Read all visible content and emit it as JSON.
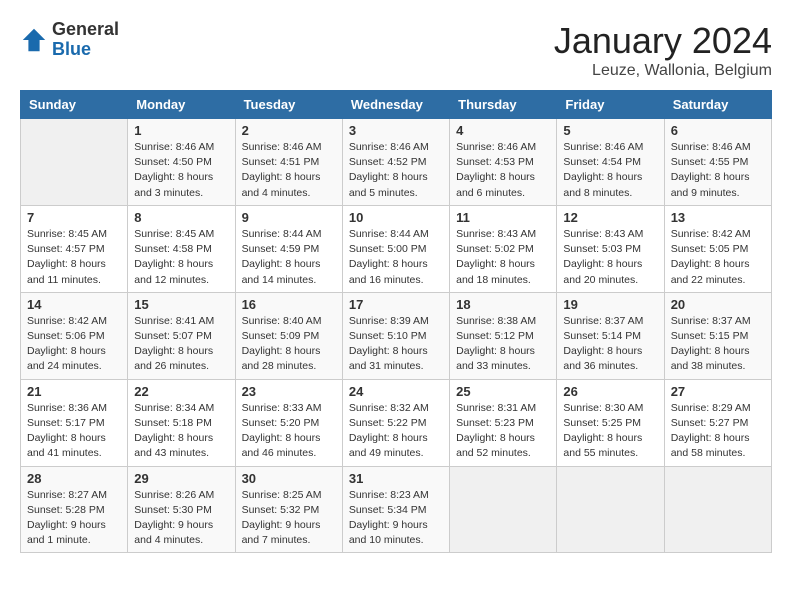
{
  "header": {
    "logo_general": "General",
    "logo_blue": "Blue",
    "month_title": "January 2024",
    "location": "Leuze, Wallonia, Belgium"
  },
  "days_of_week": [
    "Sunday",
    "Monday",
    "Tuesday",
    "Wednesday",
    "Thursday",
    "Friday",
    "Saturday"
  ],
  "weeks": [
    [
      {
        "day": "",
        "info": ""
      },
      {
        "day": "1",
        "info": "Sunrise: 8:46 AM\nSunset: 4:50 PM\nDaylight: 8 hours and 3 minutes."
      },
      {
        "day": "2",
        "info": "Sunrise: 8:46 AM\nSunset: 4:51 PM\nDaylight: 8 hours and 4 minutes."
      },
      {
        "day": "3",
        "info": "Sunrise: 8:46 AM\nSunset: 4:52 PM\nDaylight: 8 hours and 5 minutes."
      },
      {
        "day": "4",
        "info": "Sunrise: 8:46 AM\nSunset: 4:53 PM\nDaylight: 8 hours and 6 minutes."
      },
      {
        "day": "5",
        "info": "Sunrise: 8:46 AM\nSunset: 4:54 PM\nDaylight: 8 hours and 8 minutes."
      },
      {
        "day": "6",
        "info": "Sunrise: 8:46 AM\nSunset: 4:55 PM\nDaylight: 8 hours and 9 minutes."
      }
    ],
    [
      {
        "day": "7",
        "info": "Sunrise: 8:45 AM\nSunset: 4:57 PM\nDaylight: 8 hours and 11 minutes."
      },
      {
        "day": "8",
        "info": "Sunrise: 8:45 AM\nSunset: 4:58 PM\nDaylight: 8 hours and 12 minutes."
      },
      {
        "day": "9",
        "info": "Sunrise: 8:44 AM\nSunset: 4:59 PM\nDaylight: 8 hours and 14 minutes."
      },
      {
        "day": "10",
        "info": "Sunrise: 8:44 AM\nSunset: 5:00 PM\nDaylight: 8 hours and 16 minutes."
      },
      {
        "day": "11",
        "info": "Sunrise: 8:43 AM\nSunset: 5:02 PM\nDaylight: 8 hours and 18 minutes."
      },
      {
        "day": "12",
        "info": "Sunrise: 8:43 AM\nSunset: 5:03 PM\nDaylight: 8 hours and 20 minutes."
      },
      {
        "day": "13",
        "info": "Sunrise: 8:42 AM\nSunset: 5:05 PM\nDaylight: 8 hours and 22 minutes."
      }
    ],
    [
      {
        "day": "14",
        "info": "Sunrise: 8:42 AM\nSunset: 5:06 PM\nDaylight: 8 hours and 24 minutes."
      },
      {
        "day": "15",
        "info": "Sunrise: 8:41 AM\nSunset: 5:07 PM\nDaylight: 8 hours and 26 minutes."
      },
      {
        "day": "16",
        "info": "Sunrise: 8:40 AM\nSunset: 5:09 PM\nDaylight: 8 hours and 28 minutes."
      },
      {
        "day": "17",
        "info": "Sunrise: 8:39 AM\nSunset: 5:10 PM\nDaylight: 8 hours and 31 minutes."
      },
      {
        "day": "18",
        "info": "Sunrise: 8:38 AM\nSunset: 5:12 PM\nDaylight: 8 hours and 33 minutes."
      },
      {
        "day": "19",
        "info": "Sunrise: 8:37 AM\nSunset: 5:14 PM\nDaylight: 8 hours and 36 minutes."
      },
      {
        "day": "20",
        "info": "Sunrise: 8:37 AM\nSunset: 5:15 PM\nDaylight: 8 hours and 38 minutes."
      }
    ],
    [
      {
        "day": "21",
        "info": "Sunrise: 8:36 AM\nSunset: 5:17 PM\nDaylight: 8 hours and 41 minutes."
      },
      {
        "day": "22",
        "info": "Sunrise: 8:34 AM\nSunset: 5:18 PM\nDaylight: 8 hours and 43 minutes."
      },
      {
        "day": "23",
        "info": "Sunrise: 8:33 AM\nSunset: 5:20 PM\nDaylight: 8 hours and 46 minutes."
      },
      {
        "day": "24",
        "info": "Sunrise: 8:32 AM\nSunset: 5:22 PM\nDaylight: 8 hours and 49 minutes."
      },
      {
        "day": "25",
        "info": "Sunrise: 8:31 AM\nSunset: 5:23 PM\nDaylight: 8 hours and 52 minutes."
      },
      {
        "day": "26",
        "info": "Sunrise: 8:30 AM\nSunset: 5:25 PM\nDaylight: 8 hours and 55 minutes."
      },
      {
        "day": "27",
        "info": "Sunrise: 8:29 AM\nSunset: 5:27 PM\nDaylight: 8 hours and 58 minutes."
      }
    ],
    [
      {
        "day": "28",
        "info": "Sunrise: 8:27 AM\nSunset: 5:28 PM\nDaylight: 9 hours and 1 minute."
      },
      {
        "day": "29",
        "info": "Sunrise: 8:26 AM\nSunset: 5:30 PM\nDaylight: 9 hours and 4 minutes."
      },
      {
        "day": "30",
        "info": "Sunrise: 8:25 AM\nSunset: 5:32 PM\nDaylight: 9 hours and 7 minutes."
      },
      {
        "day": "31",
        "info": "Sunrise: 8:23 AM\nSunset: 5:34 PM\nDaylight: 9 hours and 10 minutes."
      },
      {
        "day": "",
        "info": ""
      },
      {
        "day": "",
        "info": ""
      },
      {
        "day": "",
        "info": ""
      }
    ]
  ]
}
